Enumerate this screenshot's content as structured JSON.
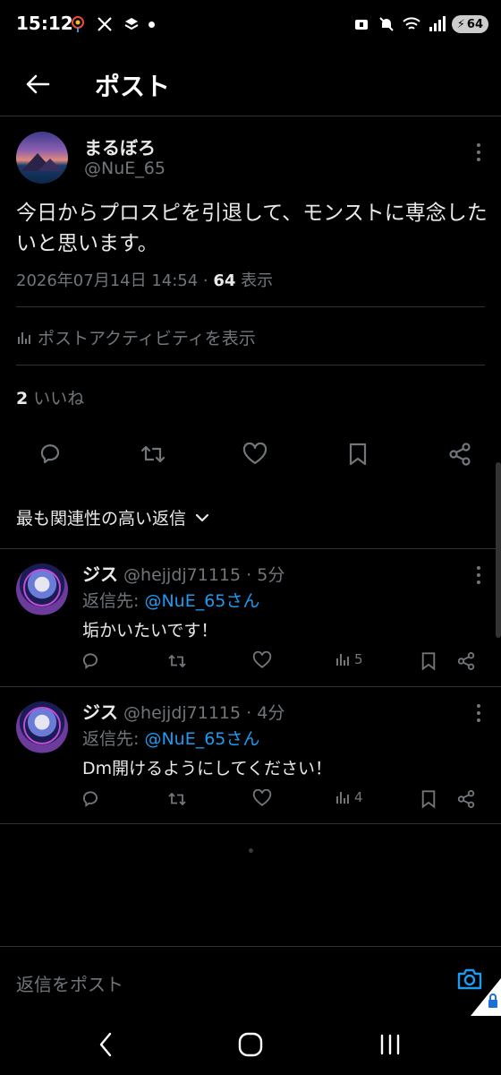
{
  "status_bar": {
    "time": "15:12",
    "battery": "64",
    "icons": [
      "location-icon",
      "x-icon",
      "layers-icon",
      "notification-dot",
      "lock-icon",
      "mute-icon",
      "wifi-icon",
      "signal-icon"
    ]
  },
  "header": {
    "title": "ポスト"
  },
  "post": {
    "author_name": "まるぼろ",
    "author_handle": "@NuE_65",
    "text": "今日からプロスピを引退して、モンストに専念したいと思います。",
    "date": "2026年07月14日 14:54 · ",
    "views_count": "64",
    "views_label": " 表示",
    "activity_label": "ポストアクティビティを表示",
    "likes_count": "2",
    "likes_label": " いいね"
  },
  "sort": {
    "label": "最も関連性の高い返信"
  },
  "replies": [
    {
      "name": "ジス",
      "handle_time": " @hejjdj71115 · 5分",
      "reply_to_prefix": "返信先: ",
      "reply_to_user": "@NuE_65さん",
      "text": "垢かいたいです！",
      "views": "5"
    },
    {
      "name": "ジス",
      "handle_time": " @hejjdj71115 · 4分",
      "reply_to_prefix": "返信先: ",
      "reply_to_user": "@NuE_65さん",
      "text": "Dm開けるようにしてください！",
      "views": "4"
    }
  ],
  "compose": {
    "placeholder": "返信をポスト"
  },
  "colors": {
    "background": "#000000",
    "text": "#e7e9ea",
    "secondary": "#71767b",
    "accent": "#1d9bf0",
    "divider": "#2f3336"
  }
}
